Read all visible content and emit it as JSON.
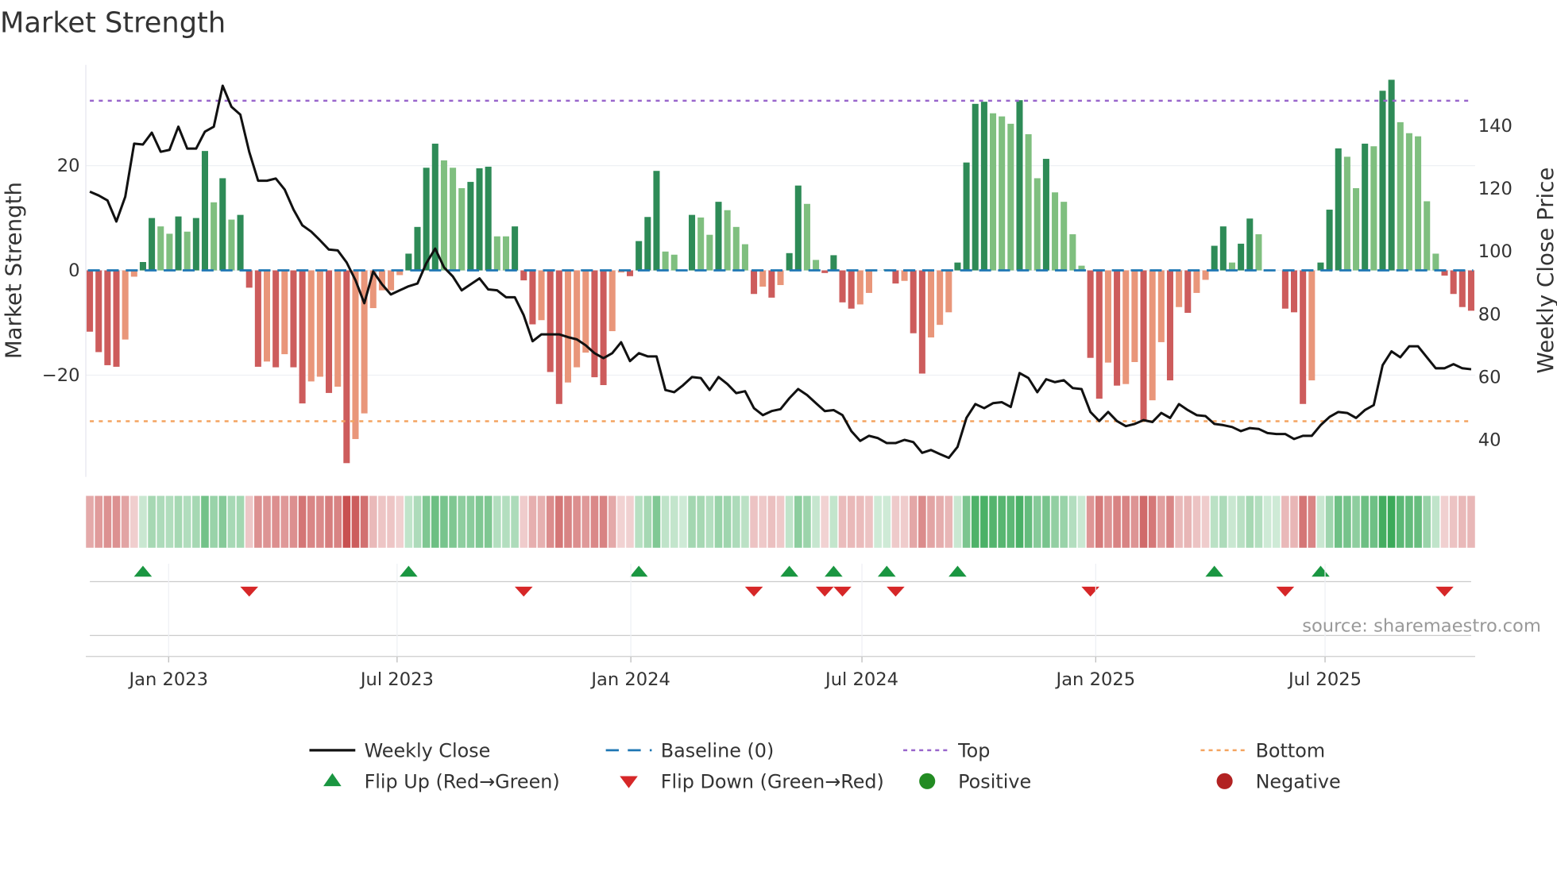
{
  "chart_data": {
    "type": "bar",
    "title": "Market Strength",
    "ylabel": "Market Strength",
    "ylabel_right": "Weekly Close Price",
    "source": "source: sharemaestro.com",
    "ylim": [
      -40,
      39
    ],
    "ylim_right": [
      28,
      165
    ],
    "y_ticks": [
      {
        "label": "20",
        "value": 20
      },
      {
        "label": "0",
        "value": 0
      },
      {
        "label": "−20",
        "value": -20
      }
    ],
    "y_ticks_right": [
      {
        "label": "140",
        "value": 140
      },
      {
        "label": "120",
        "value": 120
      },
      {
        "label": "100",
        "value": 100
      },
      {
        "label": "80",
        "value": 80
      },
      {
        "label": "60",
        "value": 60
      },
      {
        "label": "40",
        "value": 40
      }
    ],
    "x_ticks": [
      {
        "label": "Jan 2023",
        "week_index": 8.9
      },
      {
        "label": "Jul 2023",
        "week_index": 34.7
      },
      {
        "label": "Jan 2024",
        "week_index": 61.1
      },
      {
        "label": "Jul 2024",
        "week_index": 87.2
      },
      {
        "label": "Jan 2025",
        "week_index": 113.6
      },
      {
        "label": "Jul 2025",
        "week_index": 139.5
      }
    ],
    "top_level": 32.4,
    "bottom_level": -28.8,
    "baseline": 0,
    "strength": [
      -11.7,
      -15.6,
      -18.1,
      -18.4,
      -13.2,
      -1.2,
      1.6,
      10,
      8.4,
      7,
      10.3,
      7.4,
      10,
      22.8,
      13,
      17.6,
      9.7,
      10.6,
      -3.3,
      -18.4,
      -17.4,
      -18.5,
      -16,
      -18.5,
      -25.4,
      -21.2,
      -20.3,
      -23.4,
      -22.2,
      -36.8,
      -32.2,
      -27.3,
      -7.2,
      -3.8,
      -3.8,
      -0.9,
      3.2,
      8.3,
      19.6,
      24.2,
      21,
      19.6,
      15.7,
      16.9,
      19.5,
      19.8,
      6.5,
      6.5,
      8.4,
      -1.9,
      -10.3,
      -9.5,
      -19.4,
      -25.5,
      -21.4,
      -18.5,
      -15.7,
      -20.4,
      -21.9,
      -11.6,
      -0.4,
      -1.1,
      5.6,
      10.2,
      19,
      3.6,
      3,
      0,
      10.6,
      10.1,
      6.8,
      13.1,
      11.5,
      8.3,
      5,
      -4.5,
      -3.1,
      -5.2,
      -2.8,
      3.3,
      16.2,
      12.7,
      2,
      -0.5,
      2.9,
      -6.1,
      -7.3,
      -6.5,
      -4.3,
      0,
      0.2,
      -2.5,
      -2,
      -12,
      -19.7,
      -12.8,
      -10.4,
      -8,
      1.5,
      20.6,
      31.8,
      32.2,
      30,
      29.4,
      28,
      32.5,
      26,
      17.6,
      21.3,
      14.9,
      13.1,
      6.9,
      0.9,
      -16.7,
      -24.5,
      -17.6,
      -22,
      -21.7,
      -17.5,
      -28.6,
      -24.8,
      -13.7,
      -21,
      -7,
      -8.1,
      -4.3,
      -1.8,
      4.7,
      8.4,
      1.5,
      5.1,
      9.9,
      6.9,
      0,
      0,
      -7.3,
      -8,
      -25.5,
      -21,
      1.5,
      11.6,
      23.3,
      21.7,
      15.7,
      24.2,
      23.7,
      34.3,
      36.4,
      28.3,
      26.2,
      25.6,
      13.2,
      3.2,
      -1,
      -4.5,
      -7,
      -7.7
    ],
    "weekly_close": [
      118.7,
      117.5,
      115.9,
      109.2,
      117.1,
      134,
      133.7,
      137.5,
      131.4,
      132,
      139.4,
      132.4,
      132.4,
      137.8,
      139.4,
      152.4,
      145.7,
      143.2,
      131.4,
      122.2,
      122.2,
      122.9,
      119.4,
      113,
      108,
      106,
      103.2,
      100.3,
      100,
      96.2,
      90.5,
      83.2,
      93.3,
      89.2,
      86,
      87.3,
      88.6,
      89.5,
      95.9,
      100.6,
      94.6,
      91.7,
      87.3,
      89.2,
      91.1,
      87.6,
      87.3,
      85.1,
      85.1,
      79.4,
      71.1,
      73.3,
      73.3,
      73.3,
      72.4,
      71.7,
      69.8,
      67.3,
      65.7,
      67.3,
      70.8,
      64.8,
      67.3,
      66.3,
      66.3,
      55.6,
      54.9,
      57.1,
      59.7,
      59.4,
      55.6,
      59.7,
      57.5,
      54.6,
      55.2,
      49.8,
      47.6,
      48.9,
      49.5,
      53,
      55.9,
      54,
      51.4,
      48.9,
      49.2,
      47.6,
      42.5,
      39.4,
      41,
      40.3,
      38.7,
      38.7,
      39.7,
      39,
      35.6,
      36.5,
      35.2,
      34,
      37.5,
      46.7,
      51.1,
      49.8,
      51.4,
      51.7,
      50.2,
      61,
      59.4,
      54.9,
      59,
      58.1,
      58.7,
      56.2,
      55.9,
      48.6,
      45.7,
      48.6,
      45.7,
      44.1,
      44.8,
      46,
      45.4,
      48.3,
      46.7,
      51.1,
      49.2,
      47.6,
      47.3,
      44.8,
      44.4,
      43.8,
      42.5,
      43.5,
      43.2,
      41.9,
      41.6,
      41.6,
      40,
      41,
      41,
      44.4,
      47,
      48.6,
      48.3,
      46.7,
      49.2,
      50.8,
      63.5,
      67.9,
      66,
      69.5,
      69.5,
      66,
      62.5,
      62.5,
      63.8,
      62.5,
      62.2
    ],
    "flip_up_weeks": [
      6,
      36,
      62,
      79,
      84,
      90,
      98,
      127,
      139
    ],
    "flip_down_weeks": [
      18,
      49,
      75,
      83,
      85,
      91,
      113,
      135,
      153
    ],
    "legend": [
      {
        "label": "Weekly Close",
        "kind": "line"
      },
      {
        "label": "Baseline (0)",
        "kind": "dash"
      },
      {
        "label": "Top",
        "kind": "dot-top"
      },
      {
        "label": "Bottom",
        "kind": "dot-bottom"
      },
      {
        "label": "Flip Up (Red→Green)",
        "kind": "tri-up"
      },
      {
        "label": "Flip Down (Green→Red)",
        "kind": "tri-down"
      },
      {
        "label": "Positive",
        "kind": "circle-pos"
      },
      {
        "label": "Negative",
        "kind": "circle-neg"
      }
    ],
    "legend_placement": "bottom",
    "colors": {
      "pos_strong": "#2e8b57",
      "pos_weak": "#7fbf7f",
      "neg_strong": "#cd5c5c",
      "neg_weak": "#e9967a",
      "baseline": "#1f77b4",
      "top": "#9966cc",
      "bottom": "#f4a460",
      "flip_up": "#1a9641",
      "flip_down": "#d62728",
      "positive": "#228b22",
      "negative": "#b22222",
      "close": "#111111"
    }
  }
}
